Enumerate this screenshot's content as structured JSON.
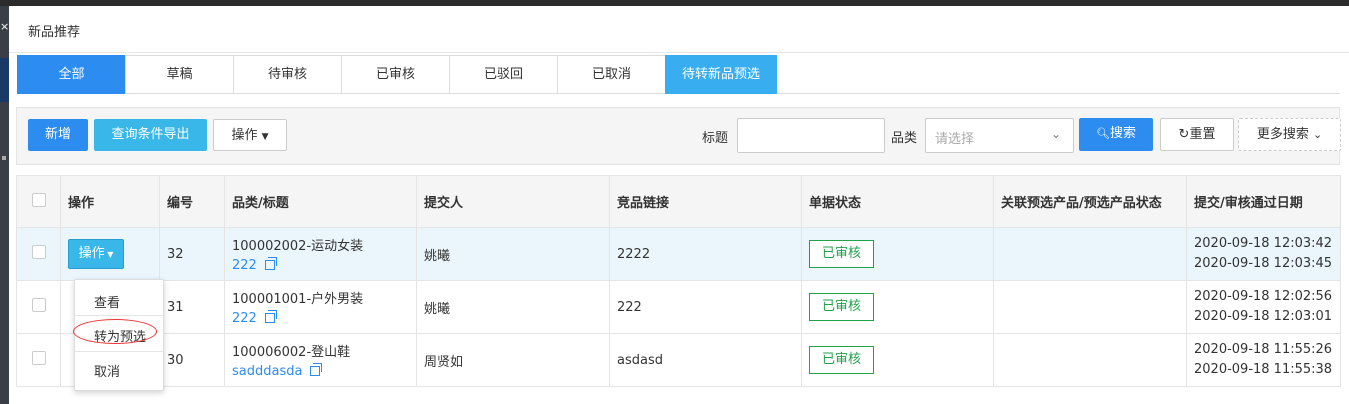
{
  "left_strip": {
    "close_glyph": "×"
  },
  "modal": {
    "title": "新品推荐"
  },
  "tabs": [
    {
      "label": "全部",
      "active": true
    },
    {
      "label": "草稿",
      "active": false
    },
    {
      "label": "待审核",
      "active": false
    },
    {
      "label": "已审核",
      "active": false
    },
    {
      "label": "已驳回",
      "active": false
    },
    {
      "label": "已取消",
      "active": false
    },
    {
      "label": "待转新品预选",
      "active": false
    }
  ],
  "toolbar": {
    "add_label": "新增",
    "export_label": "查询条件导出",
    "op_label": "操作",
    "title_label": "标题",
    "title_value": "",
    "category_label": "品类",
    "category_placeholder": "请选择",
    "search_label": "搜索",
    "reset_label": "重置",
    "more_label": "更多搜索"
  },
  "table": {
    "headers": [
      "",
      "操作",
      "编号",
      "品类/标题",
      "提交人",
      "竞品链接",
      "单据状态",
      "关联预选产品/预选产品状态",
      "提交/审核通过日期"
    ],
    "rows": [
      {
        "id": "32",
        "category": "100002002-运动女装",
        "title": "222",
        "submitter": "姚曦",
        "link": "2222",
        "status": "已审核",
        "related": "",
        "submitted": "2020-09-18 12:03:42",
        "approved": "2020-09-18 12:03:45",
        "highlighted": true,
        "action_label": "操作"
      },
      {
        "id": "31",
        "category": "100001001-户外男装",
        "title": "222",
        "submitter": "姚曦",
        "link": "222",
        "status": "已审核",
        "related": "",
        "submitted": "2020-09-18 12:02:56",
        "approved": "2020-09-18 12:03:01",
        "highlighted": false,
        "action_label": ""
      },
      {
        "id": "30",
        "category": "100006002-登山鞋",
        "title": "sadddasda",
        "submitter": "周贤如",
        "link": "asdasd",
        "status": "已审核",
        "related": "",
        "submitted": "2020-09-18 11:55:26",
        "approved": "2020-09-18 11:55:38",
        "highlighted": false,
        "action_label": ""
      }
    ]
  },
  "dropdown": {
    "items": [
      "查看",
      "转为预选",
      "取消"
    ],
    "circled_item": "转为预选"
  },
  "colors": {
    "primary": "#2d8cf0",
    "info": "#38b7e8",
    "success": "#22a04a",
    "annotation": "#e33333"
  }
}
